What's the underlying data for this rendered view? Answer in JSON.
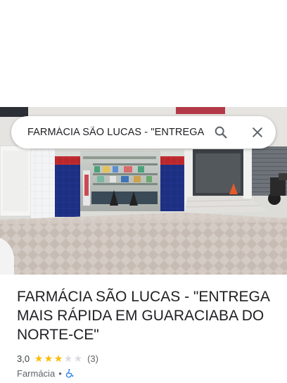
{
  "search": {
    "query": "FARMÁCIA SÃO LUCAS - \"ENTREGA"
  },
  "place": {
    "title": "FARMÁCIA SÃO LUCAS - \"ENTREGA MAIS RÁPIDA EM GUARACIABA DO NORTE-CE\"",
    "rating": "3,0",
    "rating_fraction": 0.6,
    "review_count": "(3)",
    "category": "Farmácia",
    "separator": "•"
  },
  "icons": {
    "search": "search-icon",
    "close": "close-icon",
    "accessibility": "wheelchair-icon",
    "star": "star-icon"
  },
  "colors": {
    "star_filled": "#fbbc04",
    "star_empty": "#dadce0",
    "accessibility": "#1a73e8",
    "tiles_blue": "#1d2f8a",
    "tiles_red": "#c0282e"
  }
}
